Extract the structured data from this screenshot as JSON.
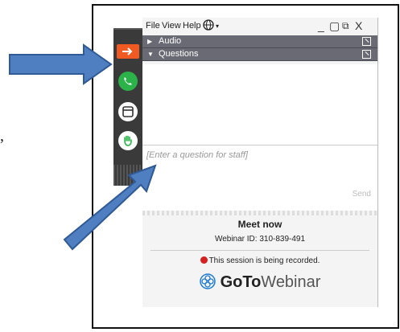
{
  "page": {
    "stray_text": ","
  },
  "menubar": {
    "items": [
      "File",
      "View",
      "Help"
    ],
    "window_controls": [
      "_",
      "▢",
      "⧉",
      "X"
    ]
  },
  "sections": [
    {
      "label": "Audio",
      "state": "collapsed"
    },
    {
      "label": "Questions",
      "state": "expanded"
    }
  ],
  "question_input": {
    "placeholder": "[Enter a question for staff]"
  },
  "send_button": "Send",
  "meeting": {
    "title": "Meet now",
    "webinar_id": "Webinar ID: 310-839-491",
    "recording_notice": "This session is being recorded."
  },
  "logo": {
    "go": "GoTo",
    "webinar": "Webinar"
  },
  "sidebar": {
    "icons": [
      "exit-arrow-icon",
      "phone-icon",
      "screen-icon",
      "raise-hand-icon"
    ]
  },
  "colors": {
    "orange": "#f05a22",
    "green": "#2bb34a",
    "arrow_blue": "#4f7fc0",
    "section_bar": "#6a6a74",
    "recording_red": "#d42020"
  }
}
